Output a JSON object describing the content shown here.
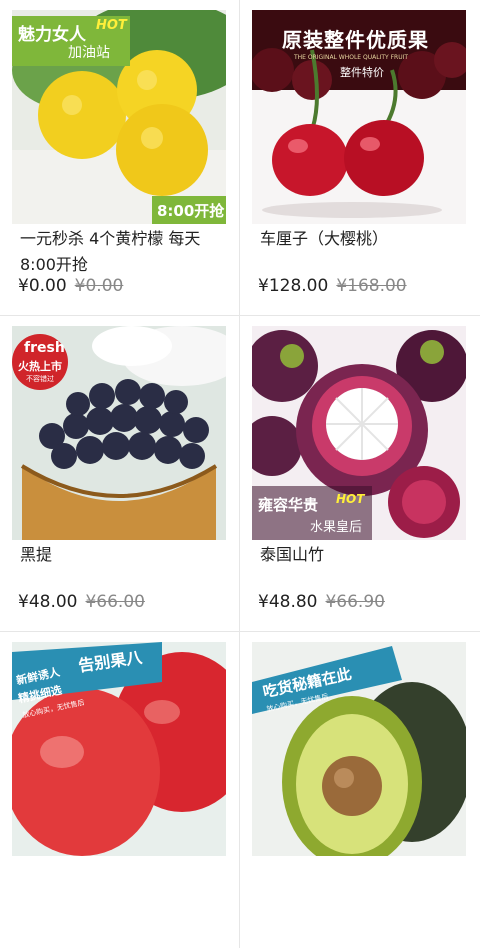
{
  "currency": "¥",
  "products": [
    {
      "name": "一元秒杀 4个黄柠檬 每天8:00开抢",
      "price": "¥0.00",
      "old_price": "¥0.00",
      "image": {
        "tag_main": "魅力女人",
        "tag_hot": "HOT",
        "tag_sub": "加油站",
        "badge": "8:00开抢"
      }
    },
    {
      "name": "车厘子（大樱桃）",
      "price": "¥128.00",
      "old_price": "¥168.00",
      "image": {
        "title": "原装整件优质果",
        "subtitle": "THE ORIGINAL WHOLE QUALITY FRUIT",
        "tag": "整件特价"
      }
    },
    {
      "name": "黑提",
      "price": "¥48.00",
      "old_price": "¥66.00",
      "image": {
        "badge_top": "fresh",
        "badge_mid": "火热上市",
        "badge_bot": "不容错过"
      }
    },
    {
      "name": "泰国山竹",
      "price": "¥48.80",
      "old_price": "¥66.90",
      "image": {
        "tag_main": "雍容华贵",
        "tag_hot": "HOT",
        "tag_sub": "水果皇后"
      }
    },
    {
      "name": "",
      "price": "",
      "old_price": "",
      "image": {
        "line1": "新鲜诱人",
        "line2": "精挑细选",
        "line3": "告别果八",
        "line4": "放心购买，无忧售后"
      }
    },
    {
      "name": "",
      "price": "",
      "old_price": "",
      "image": {
        "line1": "吃货秘籍在此",
        "line2": "放心购买，无忧售后"
      }
    }
  ]
}
